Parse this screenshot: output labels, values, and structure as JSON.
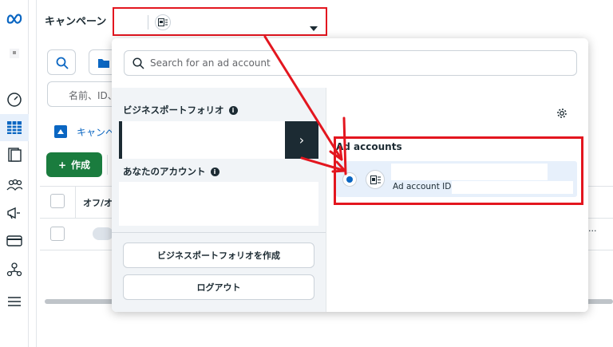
{
  "header": {
    "page_title": "キャンペーン"
  },
  "background": {
    "filter_placeholder": "名前、ID、",
    "tab_label": "キャンペ",
    "create_button_label": "作成",
    "column_onoff": "オフ/オ",
    "row_more": "..."
  },
  "dropdown": {
    "search_placeholder": "Search for an ad account",
    "business_portfolio_label": "ビジネスポートフォリオ",
    "my_accounts_label": "あなたのアカウント",
    "create_portfolio_button": "ビジネスポートフォリオを作成",
    "logout_button": "ログアウト",
    "ad_accounts_heading": "Ad accounts",
    "ad_account_id_label": "Ad account ID:",
    "portfolio_arrow_glyph": "›"
  },
  "colors": {
    "annotation_red": "#e3161f",
    "accent_blue": "#0a66c2",
    "create_green": "#1a7c3e",
    "dark": "#1c2b33",
    "selected_row_bg": "#e7f0fb"
  },
  "icons": {
    "logo": "meta-logo",
    "rail": [
      "business-logo",
      "dashboard-icon",
      "campaigns-table-icon",
      "pages-icon",
      "audiences-icon",
      "ads-megaphone-icon",
      "billing-card-icon",
      "events-icon",
      "menu-icon"
    ]
  }
}
